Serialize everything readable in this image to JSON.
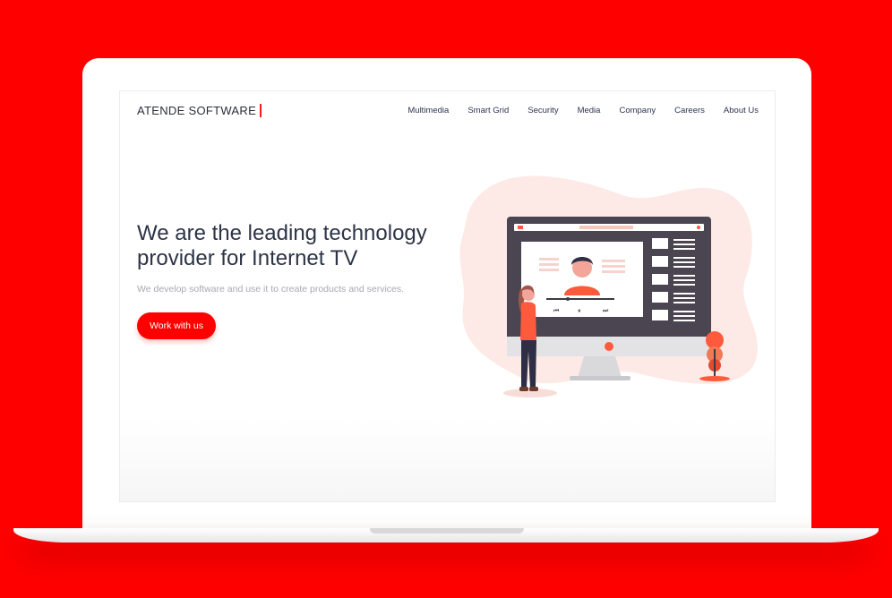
{
  "brand": {
    "name": "ATENDE SOFTWARE"
  },
  "nav": {
    "items": [
      "Multimedia",
      "Smart Grid",
      "Security",
      "Media",
      "Company",
      "Careers",
      "About Us"
    ]
  },
  "hero": {
    "title": "We are the leading technology provider for Internet TV",
    "subtitle": "We develop software and use it to create products and services.",
    "cta_label": "Work with us"
  },
  "colors": {
    "accent": "#ff0000",
    "text_dark": "#2c3446",
    "text_muted": "#a7a9b0",
    "monitor": "#4a4550",
    "blob": "#fde9e6"
  }
}
